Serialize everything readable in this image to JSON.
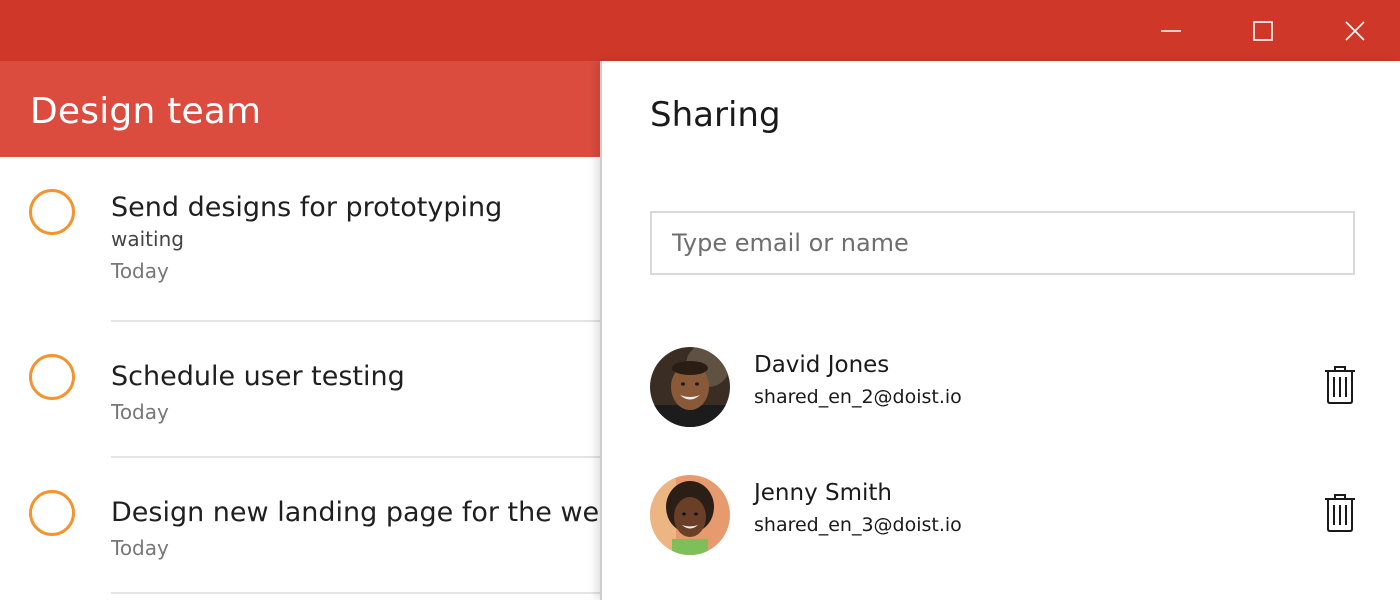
{
  "window": {
    "controls": {
      "minimize_icon": "minimize-icon",
      "maximize_icon": "maximize-icon",
      "close_icon": "close-icon"
    },
    "colors": {
      "titlebar": "#cf3828"
    }
  },
  "project": {
    "title": "Design team",
    "header_color": "#db4c3f",
    "priority_color": "#f39431",
    "tasks": [
      {
        "title": "Send designs for prototyping",
        "note": "waiting",
        "date": "Today"
      },
      {
        "title": "Schedule user testing",
        "date": "Today"
      },
      {
        "title": "Design new landing page for the web",
        "date": "Today"
      }
    ]
  },
  "sharing": {
    "title": "Sharing",
    "input_placeholder": "Type email or name",
    "collaborators": [
      {
        "name": "David Jones",
        "email": "shared_en_2@doist.io",
        "remove_icon": "trash-icon"
      },
      {
        "name": "Jenny Smith",
        "email": "shared_en_3@doist.io",
        "remove_icon": "trash-icon"
      }
    ]
  }
}
